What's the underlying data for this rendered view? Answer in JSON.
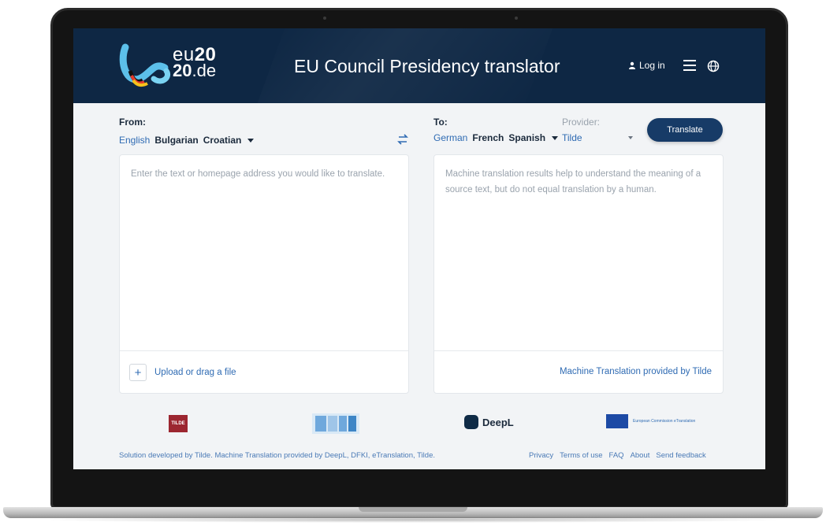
{
  "header": {
    "logo_line1_prefix": "eu",
    "logo_line1_bold": "20",
    "logo_line2_bold": "20",
    "logo_line2_suffix": ".de",
    "title": "EU Council Presidency translator",
    "login_label": "Log in"
  },
  "source": {
    "label": "From:",
    "languages": [
      "English",
      "Bulgarian",
      "Croatian"
    ],
    "placeholder": "Enter the text or homepage address you would like to translate.",
    "upload_label": "Upload or drag a file"
  },
  "target": {
    "label": "To:",
    "languages": [
      "German",
      "French",
      "Spanish"
    ],
    "provider_label": "Provider:",
    "provider_value": "Tilde",
    "translate_label": "Translate",
    "hint": "Machine translation results help to understand the meaning of a source text, but do not equal translation by a human.",
    "credit": "Machine Translation provided by Tilde"
  },
  "partners": {
    "tilde": "TILDE",
    "deepl": "DeepL",
    "etranslation": "European Commission eTranslation",
    "dfki": "DFKI"
  },
  "footer": {
    "credit": "Solution developed by Tilde. Machine Translation provided by DeepL, DFKI, eTranslation, Tilde.",
    "links": [
      "Privacy",
      "Terms of use",
      "FAQ",
      "About",
      "Send feedback"
    ]
  },
  "colors": {
    "header_bg": "#0e2744",
    "accent_link": "#2f6bb3",
    "button_bg": "#173b67"
  }
}
